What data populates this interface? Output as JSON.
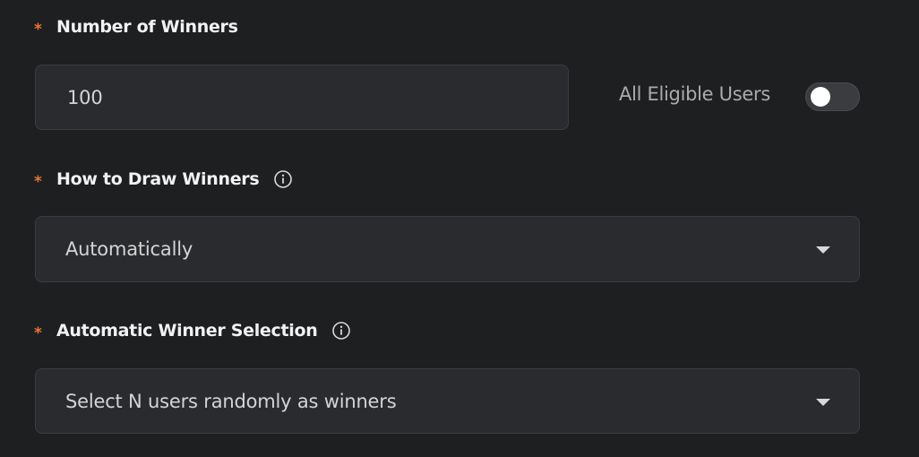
{
  "winners": {
    "required_mark": "*",
    "label": "Number of Winners",
    "value": "100",
    "toggle_label": "All Eligible Users",
    "toggle_on": false
  },
  "draw_method": {
    "required_mark": "*",
    "label": "How to Draw Winners",
    "selected": "Automatically"
  },
  "auto_selection": {
    "required_mark": "*",
    "label": "Automatic Winner Selection",
    "selected": "Select N users randomly as winners"
  },
  "colors": {
    "background": "#1e1f21",
    "field_background": "#292b2e",
    "required_mark": "#e8743b",
    "label_text": "#f2f2f2",
    "toggle_off": "#3a3c40"
  },
  "icons": {
    "info": "info-circle-icon",
    "dropdown": "chevron-down-icon"
  }
}
